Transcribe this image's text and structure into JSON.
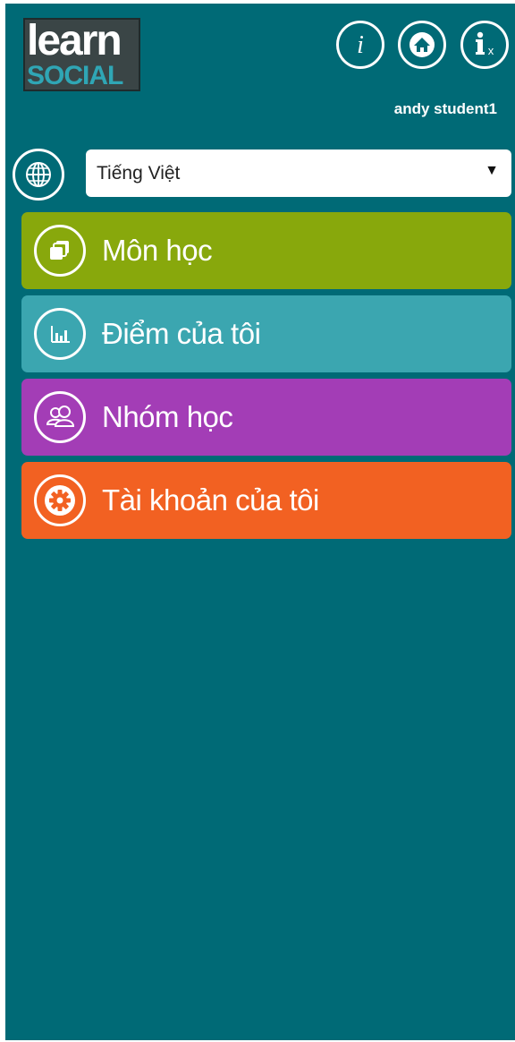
{
  "logo": {
    "line1": "learn",
    "line2": "SOCIAL"
  },
  "header": {
    "icons": [
      "info-icon",
      "home-icon",
      "accessibility-icon"
    ],
    "user_name": "andy student1"
  },
  "language": {
    "icon": "globe-icon",
    "selected": "Tiếng Việt"
  },
  "menu": [
    {
      "label": "Môn học",
      "icon": "courses-icon",
      "color": "#88a80c"
    },
    {
      "label": "Điểm của tôi",
      "icon": "grades-icon",
      "color": "#3ba6b0"
    },
    {
      "label": "Nhóm học",
      "icon": "groups-icon",
      "color": "#a33db6"
    },
    {
      "label": "Tài khoản của tôi",
      "icon": "settings-icon",
      "color": "#f26122"
    }
  ],
  "colors": {
    "background": "#006a76",
    "accent": "#ffffff"
  }
}
